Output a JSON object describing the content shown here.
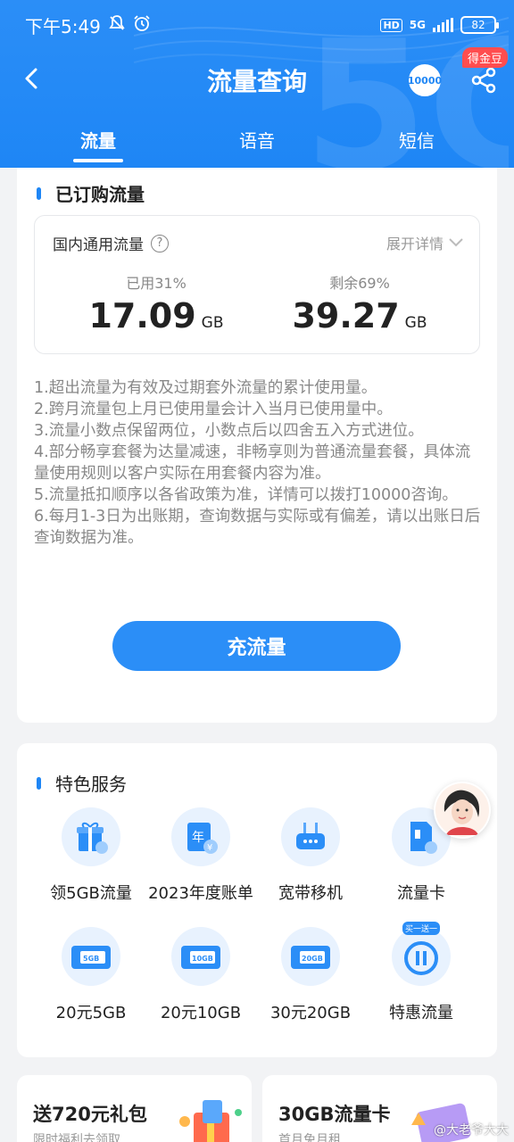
{
  "status_bar": {
    "time": "下午5:49",
    "network": "5G",
    "hd": "HD",
    "battery": "82"
  },
  "header": {
    "title": "流量查询",
    "service_icon_text": "10000",
    "reward_badge": "得金豆"
  },
  "tabs": [
    {
      "label": "流量"
    },
    {
      "label": "语音"
    },
    {
      "label": "短信"
    }
  ],
  "purchased": {
    "section_title": "已订购流量",
    "plan_label": "国内通用流量",
    "expand_label": "展开详情",
    "used_label": "已用31%",
    "used_value": "17.09",
    "remaining_label": "剩余69%",
    "remaining_value": "39.27",
    "unit": "GB",
    "used_fraction": 0.31
  },
  "notes": [
    "1.超出流量为有效及过期套外流量的累计使用量。",
    "2.跨月流量包上月已使用量会计入当月已使用量中。",
    "3.流量小数点保留两位，小数点后以四舍五入方式进位。",
    "4.部分畅享套餐为达量减速，非畅享则为普通流量套餐，具体流量使用规则以客户实际在用套餐内容为准。",
    "5.流量抵扣顺序以各省政策为准，详情可以拨打10000咨询。",
    "6.每月1-3日为出账期，查询数据与实际或有偏差，请以出账日后查询数据为准。"
  ],
  "recharge_button": "充流量",
  "featured": {
    "section_title": "特色服务",
    "items": [
      {
        "label": "领5GB流量",
        "icon": "gift-icon"
      },
      {
        "label": "2023年度账单",
        "icon": "annual-bill-icon"
      },
      {
        "label": "宽带移机",
        "icon": "router-icon"
      },
      {
        "label": "流量卡",
        "icon": "sim-card-icon"
      },
      {
        "label": "20元5GB",
        "icon": "ticket-icon",
        "tag": "5GB"
      },
      {
        "label": "20元10GB",
        "icon": "ticket-icon",
        "tag": "10GB"
      },
      {
        "label": "30元20GB",
        "icon": "ticket-icon",
        "tag": "20GB"
      },
      {
        "label": "特惠流量",
        "icon": "discount-icon",
        "tag": "买一送一"
      }
    ]
  },
  "promos": [
    {
      "title": "送720元礼包",
      "subtitle": "限时福利去领取"
    },
    {
      "title": "30GB流量卡",
      "subtitle": "首月免月租"
    }
  ],
  "watermark": "@大老爷大大",
  "colors": {
    "primary": "#1e86f5",
    "badge": "#ff4d4f"
  }
}
